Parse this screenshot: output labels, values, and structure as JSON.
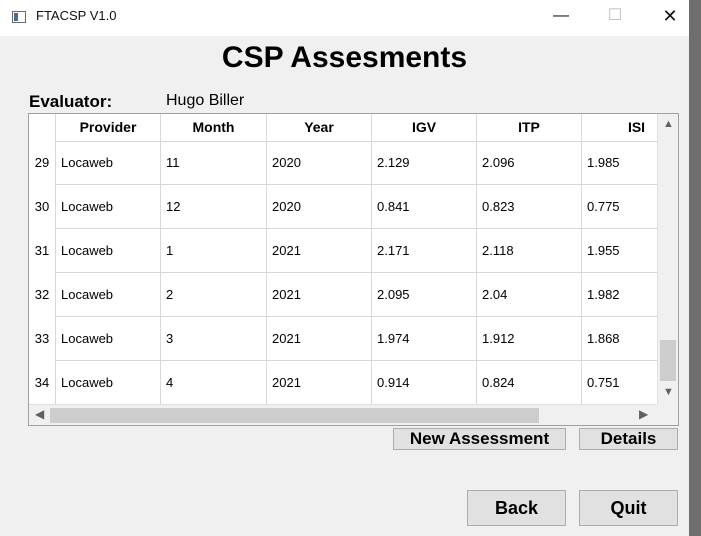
{
  "window": {
    "title": "FTACSP V1.0",
    "minimize": "—",
    "maximize": "☐",
    "close": "✕"
  },
  "heading": "CSP Assesments",
  "evaluator": {
    "label": "Evaluator:",
    "name": "Hugo Biller"
  },
  "table": {
    "columns": [
      "Provider",
      "Month",
      "Year",
      "IGV",
      "ITP",
      "ISI"
    ],
    "rows": [
      {
        "num": "29",
        "cells": [
          "Locaweb",
          "11",
          "2020",
          "2.129",
          "2.096",
          "1.985"
        ]
      },
      {
        "num": "30",
        "cells": [
          "Locaweb",
          "12",
          "2020",
          "0.841",
          "0.823",
          "0.775"
        ]
      },
      {
        "num": "31",
        "cells": [
          "Locaweb",
          "1",
          "2021",
          "2.171",
          "2.118",
          "1.955"
        ]
      },
      {
        "num": "32",
        "cells": [
          "Locaweb",
          "2",
          "2021",
          "2.095",
          "2.04",
          "1.982"
        ]
      },
      {
        "num": "33",
        "cells": [
          "Locaweb",
          "3",
          "2021",
          "1.974",
          "1.912",
          "1.868"
        ]
      },
      {
        "num": "34",
        "cells": [
          "Locaweb",
          "4",
          "2021",
          "0.914",
          "0.824",
          "0.751"
        ]
      }
    ]
  },
  "buttons": {
    "new_assessment": "New Assessment",
    "details": "Details",
    "back": "Back",
    "quit": "Quit"
  }
}
